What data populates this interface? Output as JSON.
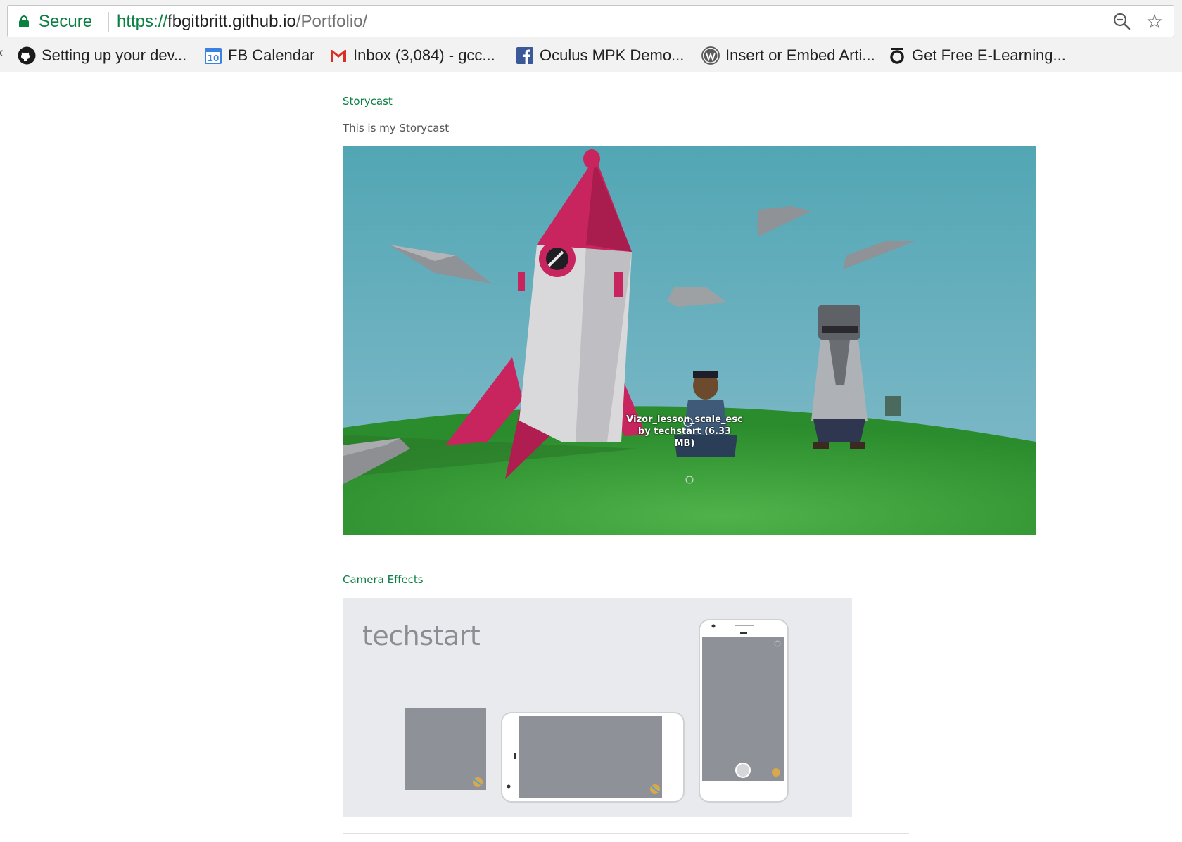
{
  "browser": {
    "secure_label": "Secure",
    "url_scheme": "https://",
    "url_host": "fbgitbritt.github.io",
    "url_path": "/Portfolio/",
    "zoom_icon": "zoom-out-icon",
    "star_icon": "star-icon"
  },
  "bookmarks": [
    {
      "label": "Setting up your dev...",
      "icon": "github-icon"
    },
    {
      "label": "FB Calendar",
      "icon": "calendar-icon",
      "badge": "10"
    },
    {
      "label": "Inbox (3,084) - gcc...",
      "icon": "gmail-icon"
    },
    {
      "label": "Oculus MPK Demo...",
      "icon": "facebook-icon"
    },
    {
      "label": "Insert or Embed Arti...",
      "icon": "wordpress-icon"
    },
    {
      "label": "Get Free E-Learning...",
      "icon": "elearning-icon"
    }
  ],
  "storycast": {
    "title": "Storycast",
    "description": "This is my Storycast",
    "embed_caption_line1": "Vizor_lesson_scale_esc",
    "embed_caption_line2": "by techstart (6.33",
    "embed_caption_line3": "MB)"
  },
  "camera_effects": {
    "title": "Camera Effects",
    "brand": "techstart"
  },
  "colors": {
    "link_green": "#0b8043",
    "sky": "#6aaebc",
    "grass": "#3aa03a",
    "rocket_pink": "#c8255e"
  }
}
